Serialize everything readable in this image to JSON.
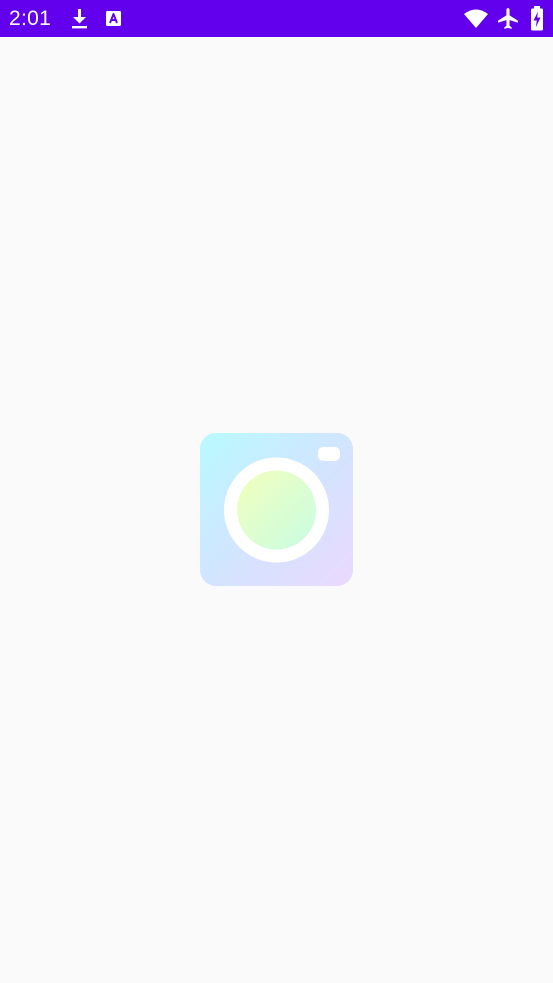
{
  "status_bar": {
    "time": "2:01",
    "background_color": "#6200EE",
    "icons_left": [
      "download-icon",
      "accessibility-a-icon"
    ],
    "icons_right": [
      "wifi-icon",
      "airplane-mode-icon",
      "battery-charging-icon"
    ]
  },
  "splash": {
    "logo_icon": "camera-icon",
    "gradient_colors": [
      "#B8FAFF",
      "#D4E3FF",
      "#EBD9FF"
    ],
    "lens_gradient_colors": [
      "#F6FFB8",
      "#C4FCE8"
    ],
    "background_color": "#FAFAFA"
  }
}
